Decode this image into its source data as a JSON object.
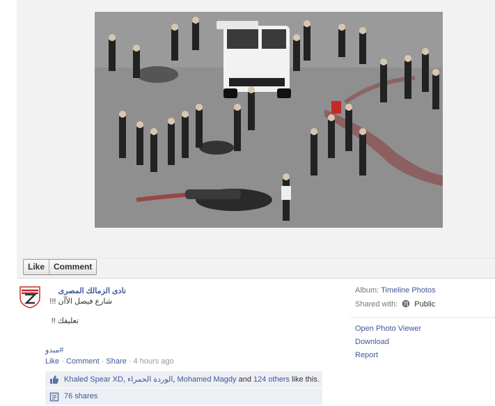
{
  "actions": {
    "like": "Like",
    "comment": "Comment"
  },
  "post": {
    "page_name": "نادى الزمالك المصرى",
    "caption": "شارع فيصل الأآن !!!",
    "comment_note": "تعليقك !!",
    "hashtag": "#مبدو",
    "meta": {
      "like": "Like",
      "sep": " · ",
      "comment": "Comment",
      "share": "Share",
      "time": "4 hours ago"
    },
    "likes": {
      "user1": "Khaled Spear XD",
      "comma1": ", ",
      "user2": "الوردة الحمراء",
      "comma2": ", ",
      "user3": "Mohamed Magdy",
      "and": " and ",
      "others": "124 others",
      "suffix": " like this."
    },
    "shares": "76 shares"
  },
  "sidebar": {
    "album_label": "Album:",
    "album_value": "Timeline Photos",
    "shared_label": "Shared with:",
    "shared_value": "Public",
    "links": [
      "Open Photo Viewer",
      "Download",
      "Report"
    ]
  },
  "colors": {
    "link": "#3b5998",
    "ufi_bg": "#edeff4",
    "stage_bg": "#f2f2f2"
  },
  "icons": {
    "like": "thumbs-up-icon",
    "share": "share-icon",
    "privacy": "globe-icon"
  }
}
